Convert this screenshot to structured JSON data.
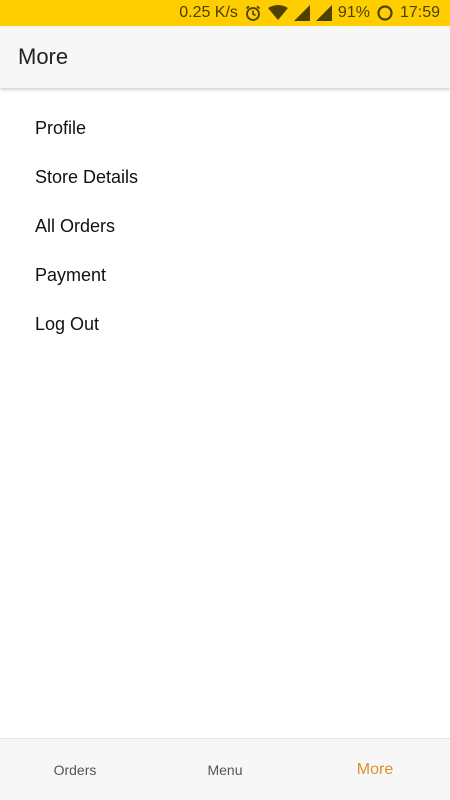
{
  "status_bar": {
    "speed": "0.25 K/s",
    "battery": "91%",
    "time": "17:59",
    "icons": [
      "alarm-icon",
      "wifi-icon",
      "signal-icon",
      "signal-icon",
      "battery-saver-icon"
    ],
    "background_color": "#ffce00"
  },
  "app_bar": {
    "title": "More"
  },
  "menu": {
    "items": [
      {
        "label": "Profile"
      },
      {
        "label": "Store Details"
      },
      {
        "label": "All Orders"
      },
      {
        "label": "Payment"
      },
      {
        "label": "Log Out"
      }
    ]
  },
  "bottom_nav": {
    "tabs": [
      {
        "label": "Orders",
        "active": false
      },
      {
        "label": "Menu",
        "active": false
      },
      {
        "label": "More",
        "active": true
      }
    ],
    "active_color": "#e0902a"
  }
}
